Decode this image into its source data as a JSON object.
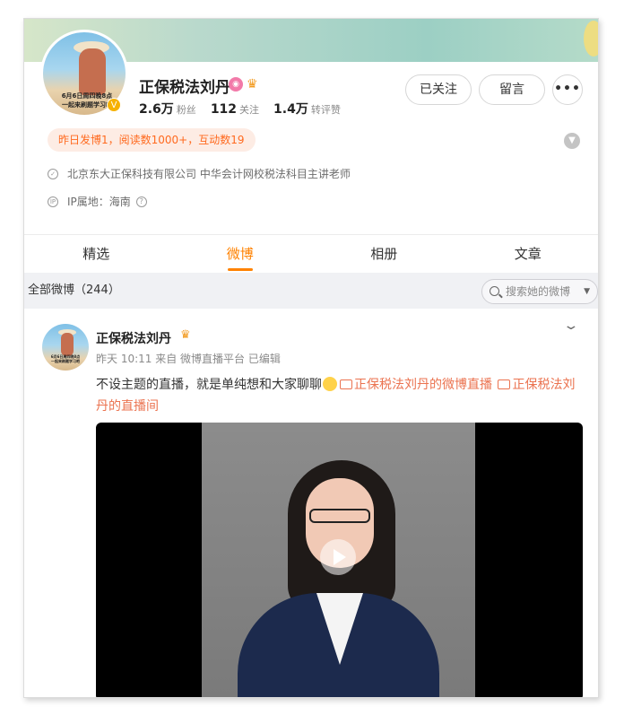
{
  "profile": {
    "name": "正保税法刘丹",
    "avatar_caption_line1": "6月6日周四晚8点",
    "avatar_caption_line2": "一起来刷题学习吧",
    "stats": [
      {
        "num": "2.6万",
        "label": "粉丝"
      },
      {
        "num": "112",
        "label": "关注"
      },
      {
        "num": "1.4万",
        "label": "转评赞"
      }
    ],
    "follow_button": "已关注",
    "message_button": "留言",
    "more_button": "•••",
    "activity": "昨日发博1，阅读数1000+，互动数19",
    "company": "北京东大正保科技有限公司 中华会计网校税法科目主讲老师",
    "ip_location": "IP属地：海南"
  },
  "tabs": [
    {
      "label": "精选"
    },
    {
      "label": "微博"
    },
    {
      "label": "相册"
    },
    {
      "label": "文章"
    }
  ],
  "filter": {
    "all_label": "全部微博（244）",
    "search_placeholder": "搜索她的微博"
  },
  "post": {
    "author": "正保税法刘丹",
    "meta": "昨天 10:11  来自 微博直播平台  已编辑",
    "text_plain": "不设主题的直播，就是单纯想和大家聊聊",
    "link1": "正保税法刘丹的微博直播",
    "link2": "正保税法刘丹的直播间"
  },
  "colors": {
    "accent": "#ff8200",
    "link": "#eb7350",
    "activity_bg": "#fdece4"
  }
}
